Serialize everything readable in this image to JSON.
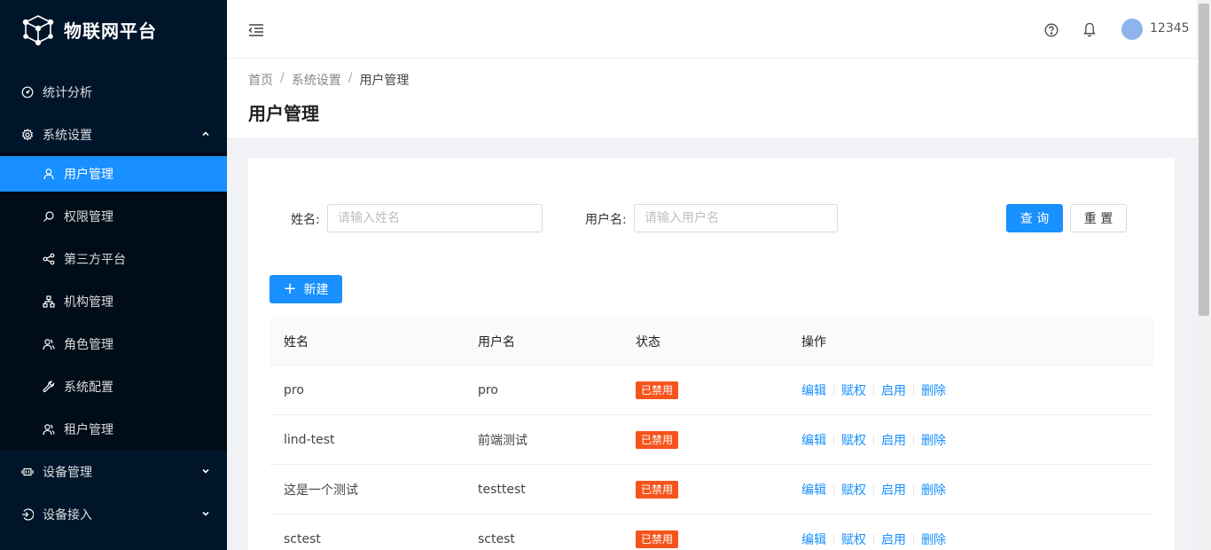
{
  "app": {
    "title": "物联网平台"
  },
  "sidebar": {
    "items": [
      {
        "label": "统计分析",
        "icon": "dashboard-icon"
      },
      {
        "label": "系统设置",
        "icon": "gear-icon",
        "expanded": true,
        "children": [
          {
            "label": "用户管理",
            "icon": "user-icon",
            "active": true
          },
          {
            "label": "权限管理",
            "icon": "search-icon"
          },
          {
            "label": "第三方平台",
            "icon": "share-icon"
          },
          {
            "label": "机构管理",
            "icon": "org-tree-icon"
          },
          {
            "label": "角色管理",
            "icon": "users-icon"
          },
          {
            "label": "系统配置",
            "icon": "wrench-icon"
          },
          {
            "label": "租户管理",
            "icon": "users-icon"
          }
        ]
      },
      {
        "label": "设备管理",
        "icon": "device-icon",
        "expanded": false
      },
      {
        "label": "设备接入",
        "icon": "login-icon",
        "expanded": false
      }
    ]
  },
  "header": {
    "username": "12345"
  },
  "breadcrumb": [
    "首页",
    "系统设置",
    "用户管理"
  ],
  "page": {
    "title": "用户管理"
  },
  "search": {
    "name_label": "姓名:",
    "name_placeholder": "请输入姓名",
    "username_label": "用户名:",
    "username_placeholder": "请输入用户名",
    "query_label": "查 询",
    "reset_label": "重 置"
  },
  "toolbar": {
    "new_label": "新建"
  },
  "table": {
    "columns": [
      "姓名",
      "用户名",
      "状态",
      "操作"
    ],
    "rows": [
      {
        "name": "pro",
        "username": "pro",
        "status": "已禁用"
      },
      {
        "name": "lind-test",
        "username": "前端测试",
        "status": "已禁用"
      },
      {
        "name": "这是一个测试",
        "username": "testtest",
        "status": "已禁用"
      },
      {
        "name": "sctest",
        "username": "sctest",
        "status": "已禁用"
      }
    ],
    "actions": [
      "编辑",
      "赋权",
      "启用",
      "删除"
    ]
  },
  "colors": {
    "sidebar_bg": "#001529",
    "accent": "#1890ff",
    "status_disabled": "#f5541c"
  }
}
